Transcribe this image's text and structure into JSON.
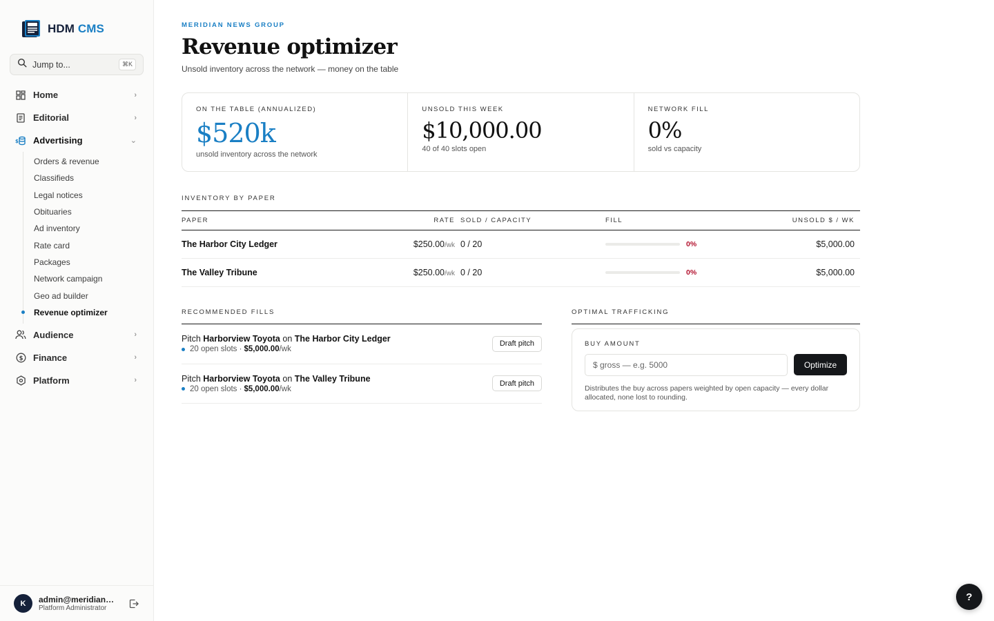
{
  "brand": {
    "name": "HDM",
    "accent": "CMS"
  },
  "sidebar": {
    "search_placeholder": "Jump to...",
    "search_shortcut": "⌘K",
    "nav": [
      {
        "label": "Home",
        "icon": "grid-icon"
      },
      {
        "label": "Editorial",
        "icon": "document-icon"
      },
      {
        "label": "Advertising",
        "icon": "money-stack-icon"
      },
      {
        "label": "Audience",
        "icon": "people-icon"
      },
      {
        "label": "Finance",
        "icon": "dollar-circle-icon"
      },
      {
        "label": "Platform",
        "icon": "hexagon-icon"
      }
    ],
    "advertising_sub": [
      "Orders & revenue",
      "Classifieds",
      "Legal notices",
      "Obituaries",
      "Ad inventory",
      "Rate card",
      "Packages",
      "Network campaign",
      "Geo ad builder",
      "Revenue optimizer"
    ],
    "user": {
      "initial": "K",
      "email": "admin@meridian.n...",
      "role": "Platform Administrator"
    }
  },
  "page": {
    "eyebrow": "MERIDIAN NEWS GROUP",
    "title": "Revenue optimizer",
    "subtitle": "Unsold inventory across the network — money on the table"
  },
  "kpis": [
    {
      "label": "ON THE TABLE (ANNUALIZED)",
      "value": "$520k",
      "sub": "unsold inventory across the network"
    },
    {
      "label": "UNSOLD THIS WEEK",
      "value": "$10,000.00",
      "sub": "40 of 40 slots open"
    },
    {
      "label": "NETWORK FILL",
      "value": "0%",
      "sub": "sold vs capacity"
    }
  ],
  "inventory": {
    "label": "INVENTORY BY PAPER",
    "headers": {
      "paper": "PAPER",
      "rate": "RATE",
      "sold": "SOLD / CAPACITY",
      "fill": "FILL",
      "unsold": "UNSOLD $ / WK"
    },
    "rows": [
      {
        "paper": "The Harbor City Ledger",
        "rate": "$250.00",
        "rate_unit": "/wk",
        "sold": "0 / 20",
        "fill": 0,
        "fill_label": "0%",
        "unsold": "$5,000.00"
      },
      {
        "paper": "The Valley Tribune",
        "rate": "$250.00",
        "rate_unit": "/wk",
        "sold": "0 / 20",
        "fill": 0,
        "fill_label": "0%",
        "unsold": "$5,000.00"
      }
    ]
  },
  "recommended": {
    "label": "RECOMMENDED FILLS",
    "items": [
      {
        "pitch": "Pitch",
        "advertiser": "Harborview Toyota",
        "on": "on",
        "paper": "The Harbor City Ledger",
        "slots": "20 open slots ·",
        "amount": "$5,000.00",
        "unit": "/wk",
        "button": "Draft pitch"
      },
      {
        "pitch": "Pitch",
        "advertiser": "Harborview Toyota",
        "on": "on",
        "paper": "The Valley Tribune",
        "slots": "20 open slots ·",
        "amount": "$5,000.00",
        "unit": "/wk",
        "button": "Draft pitch"
      }
    ]
  },
  "trafficking": {
    "label": "OPTIMAL TRAFFICKING",
    "field_label": "BUY AMOUNT",
    "placeholder": "$ gross — e.g. 5000",
    "button": "Optimize",
    "note": "Distributes the buy across papers weighted by open capacity — every dollar allocated, none lost to rounding."
  },
  "help": {
    "label": "?"
  },
  "colors": {
    "accent": "#1a7fc4",
    "danger": "#b3122e",
    "dark": "#15171a"
  }
}
